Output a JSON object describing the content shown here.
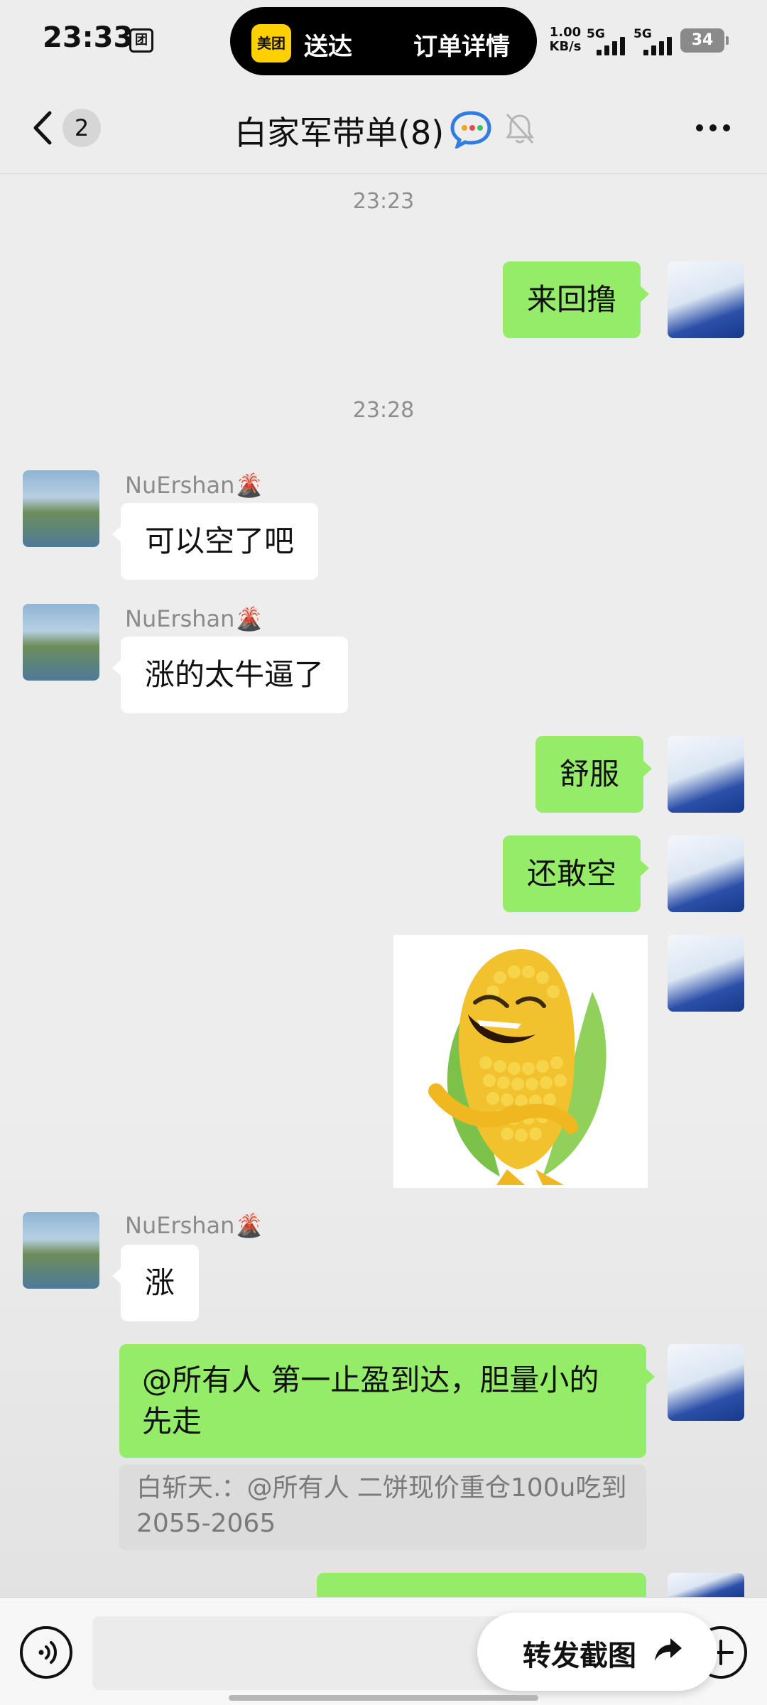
{
  "status_bar": {
    "time": "23:33",
    "app_icon_glyph": "团",
    "island": {
      "app_logo": "美团",
      "left_text": "送达",
      "right_text": "订单详情"
    },
    "net_speed_value": "1.00",
    "net_speed_unit": "KB/s",
    "signal1": "5G",
    "signal2": "5G",
    "battery": "34"
  },
  "nav": {
    "unread_count": "2",
    "title": "白家军带单(8)",
    "icons": [
      "back-icon",
      "group-chat-icon",
      "mute-bell-icon",
      "more-icon"
    ]
  },
  "messages": {
    "ts1": "23:23",
    "m1": "来回撸",
    "ts2": "23:28",
    "m2_sender": "NuErshan🌋",
    "m2": "可以空了吧",
    "m3_sender": "NuErshan🌋",
    "m3": "涨的太牛逼了",
    "m4": "舒服",
    "m5": "还敢空",
    "m7_sender": "NuErshan🌋",
    "m7": "涨",
    "m8": "@所有人  第一止盈到达，胆量小的先走",
    "m8_quote": "白斩天.：@所有人 二饼现价重仓100u吃到2055-2065"
  },
  "input_bar": {
    "forward_label": "转发截图"
  },
  "colors": {
    "chat_bg": "#ededed",
    "outgoing_bubble": "#95ec69",
    "incoming_bubble": "#ffffff",
    "quote_bg": "#dcdcdc"
  }
}
